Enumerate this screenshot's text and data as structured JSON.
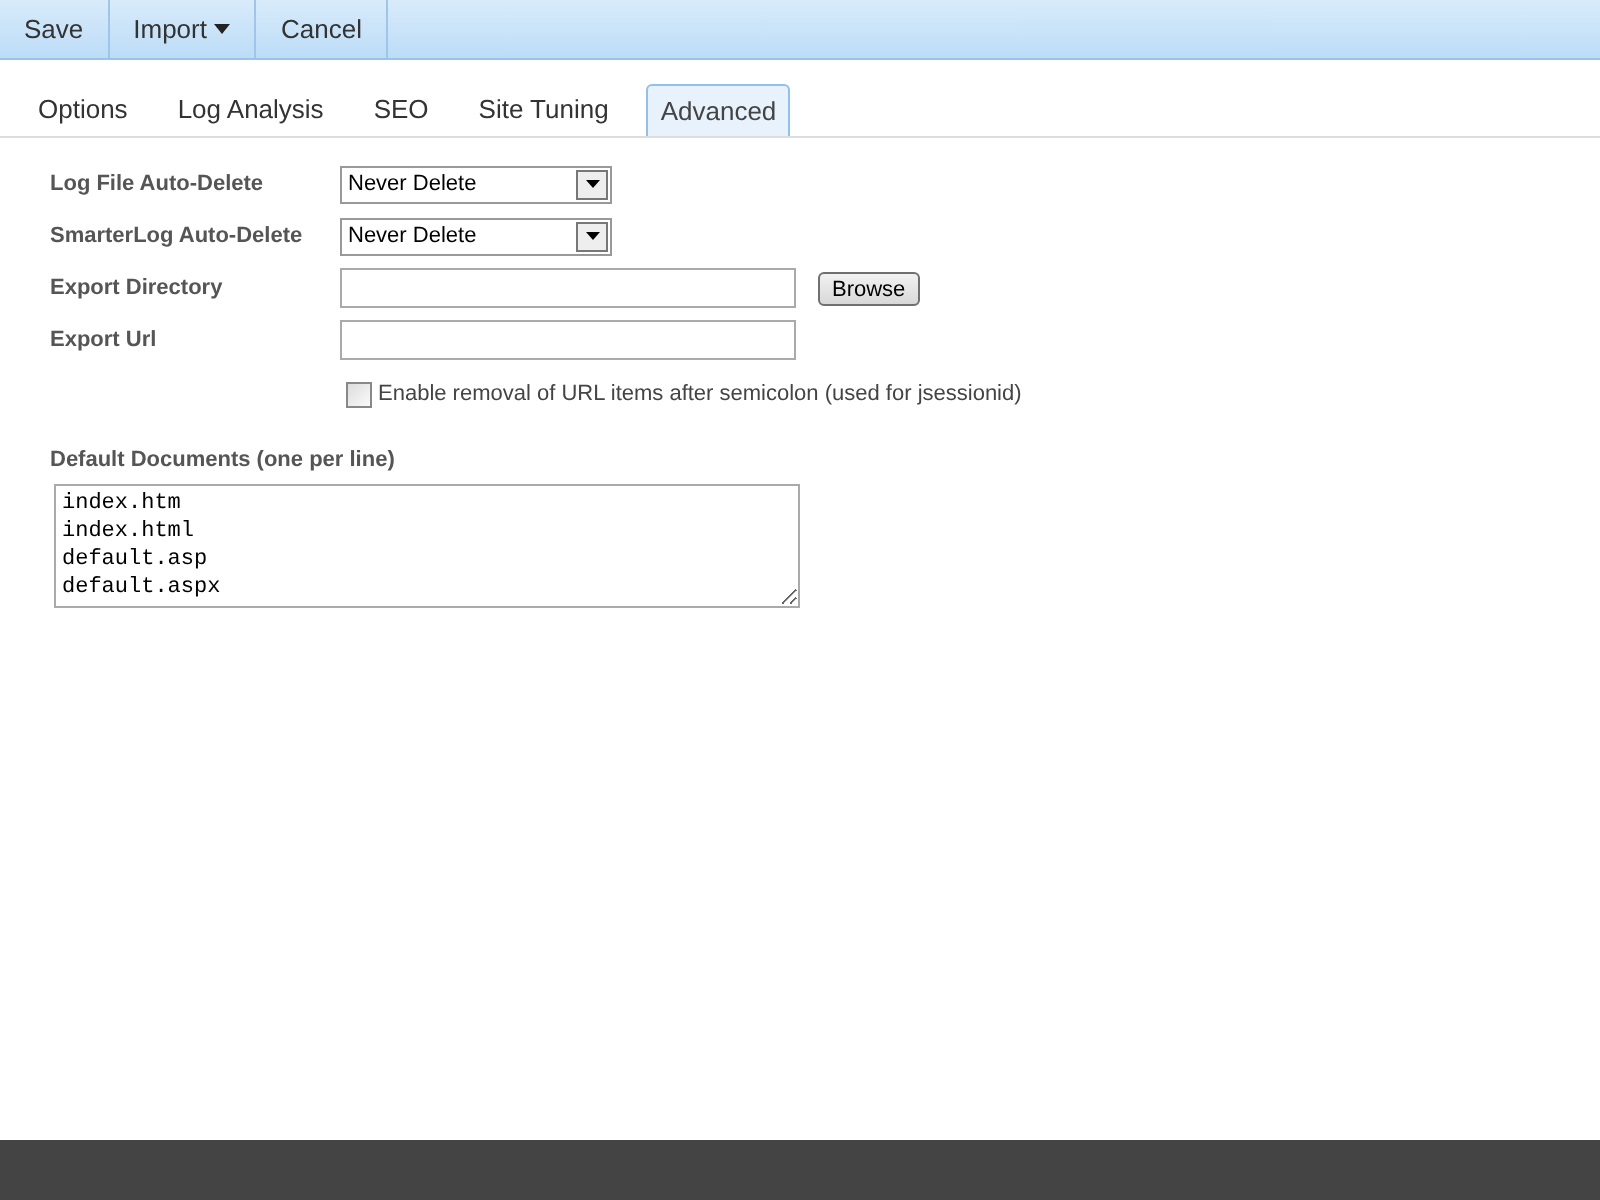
{
  "toolbar": [
    {
      "label": "Save",
      "dropdown": false
    },
    {
      "label": "Import",
      "dropdown": true
    },
    {
      "label": "Cancel",
      "dropdown": false
    }
  ],
  "tabs": [
    {
      "label": "Options",
      "selected": false
    },
    {
      "label": "Log Analysis",
      "selected": false
    },
    {
      "label": "SEO",
      "selected": false
    },
    {
      "label": "Site Tuning",
      "selected": false
    },
    {
      "label": "Advanced",
      "selected": true
    }
  ],
  "fields": [
    {
      "kind": "select",
      "label": "Log File Auto-Delete",
      "value": "Never Delete"
    },
    {
      "kind": "select",
      "label": "SmarterLog Auto-Delete",
      "value": "Never Delete"
    },
    {
      "kind": "browse",
      "label": "Export Directory",
      "button": "Browse"
    },
    {
      "kind": "text",
      "label": "Export Url"
    }
  ],
  "checkbox": {
    "label": "Enable removal of URL items after semicolon (used for jsessionid)",
    "checked": false
  },
  "default_documents": {
    "label": "Default Documents (one per line)",
    "lines": [
      "index.htm",
      "index.html",
      "default.asp",
      "default.aspx"
    ]
  }
}
